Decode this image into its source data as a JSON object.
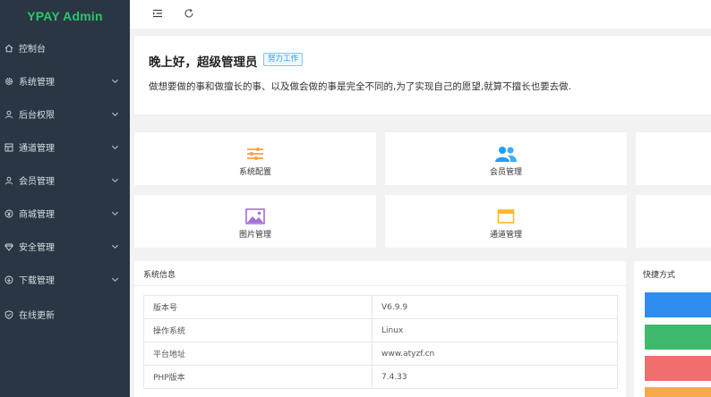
{
  "app": {
    "logo": "YPAY Admin",
    "brand_color": "#28c76f"
  },
  "sidebar": {
    "items": [
      {
        "label": "控制台",
        "icon": "home-icon",
        "has_children": false
      },
      {
        "label": "系统管理",
        "icon": "gear-icon",
        "has_children": true
      },
      {
        "label": "后台权限",
        "icon": "user-icon",
        "has_children": true
      },
      {
        "label": "通道管理",
        "icon": "channel-icon",
        "has_children": true
      },
      {
        "label": "会员管理",
        "icon": "member-icon",
        "has_children": true
      },
      {
        "label": "商城管理",
        "icon": "yen-icon",
        "has_children": true
      },
      {
        "label": "安全管理",
        "icon": "shield-diamond-icon",
        "has_children": true
      },
      {
        "label": "下载管理",
        "icon": "download-icon",
        "has_children": true
      },
      {
        "label": "在线更新",
        "icon": "check-shield-icon",
        "has_children": false
      }
    ]
  },
  "topbar": {
    "menu_toggle_icon": "menu-fold-icon",
    "refresh_icon": "refresh-icon"
  },
  "welcome": {
    "greeting": "晚上好，超级管理员",
    "badge": "努力工作",
    "motto": "做想要做的事和做擅长的事、以及做会做的事是完全不同的,为了实现自己的愿望,就算不擅长也要去做."
  },
  "shortcuts": [
    {
      "label": "系统配置",
      "icon": "sliders-icon",
      "color": "#ff9f43"
    },
    {
      "label": "会员管理",
      "icon": "users-icon",
      "color": "#1e9fff"
    },
    {
      "label": "",
      "icon": "",
      "color": ""
    },
    {
      "label": "图片管理",
      "icon": "image-icon",
      "color": "#a66fd6"
    },
    {
      "label": "通道管理",
      "icon": "window-icon",
      "color": "#ffb822"
    },
    {
      "label": "",
      "icon": "",
      "color": ""
    }
  ],
  "system_info": {
    "title": "系统信息",
    "rows": [
      {
        "key": "版本号",
        "value": "V6.9.9"
      },
      {
        "key": "操作系统",
        "value": "Linux"
      },
      {
        "key": "平台地址",
        "value": "www.atyzf.cn"
      },
      {
        "key": "PHP版本",
        "value": "7.4.33"
      }
    ]
  },
  "quick": {
    "title": "快捷方式",
    "buttons": [
      {
        "color": "#2d8cf0"
      },
      {
        "color": "#3fba6d"
      },
      {
        "color": "#f06e6e"
      },
      {
        "color": "#f5a94a"
      }
    ]
  }
}
